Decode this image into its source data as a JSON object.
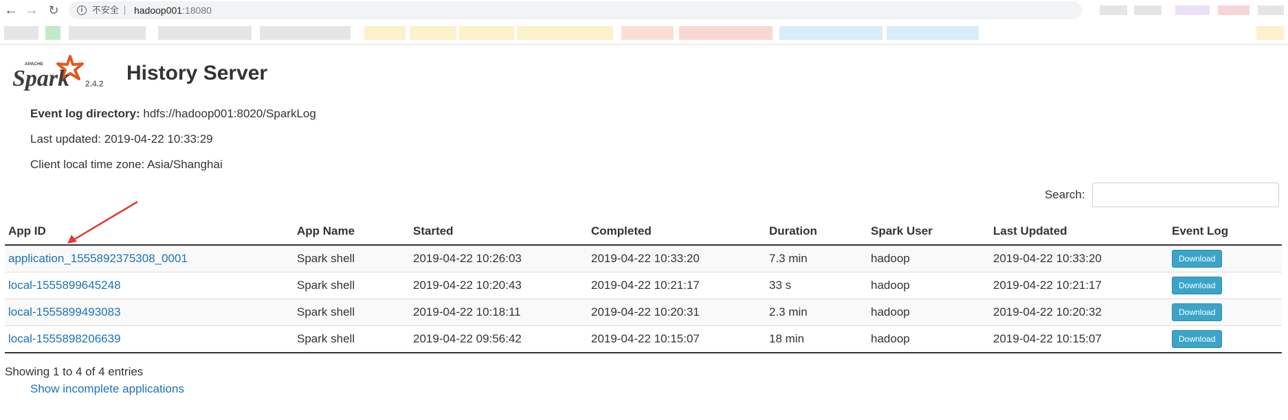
{
  "browser": {
    "insecure_label": "不安全",
    "url_host": "hadoop001",
    "url_port": ":18080"
  },
  "header": {
    "brand": "Spark",
    "brand_small": "APACHE",
    "version": "2.4.2",
    "title": "History Server"
  },
  "info": {
    "event_log_label": "Event log directory:",
    "event_log_value": "hdfs://hadoop001:8020/SparkLog",
    "last_updated": "Last updated: 2019-04-22 10:33:29",
    "timezone": "Client local time zone: Asia/Shanghai"
  },
  "search": {
    "label": "Search:",
    "placeholder": "",
    "value": ""
  },
  "table": {
    "columns": [
      "App ID",
      "App Name",
      "Started",
      "Completed",
      "Duration",
      "Spark User",
      "Last Updated",
      "Event Log"
    ],
    "rows": [
      {
        "app_id": "application_1555892375308_0001",
        "app_name": "Spark shell",
        "started": "2019-04-22 10:26:03",
        "completed": "2019-04-22 10:33:20",
        "duration": "7.3 min",
        "user": "hadoop",
        "last_updated": "2019-04-22 10:33:20",
        "event_log": "Download"
      },
      {
        "app_id": "local-1555899645248",
        "app_name": "Spark shell",
        "started": "2019-04-22 10:20:43",
        "completed": "2019-04-22 10:21:17",
        "duration": "33 s",
        "user": "hadoop",
        "last_updated": "2019-04-22 10:21:17",
        "event_log": "Download"
      },
      {
        "app_id": "local-1555899493083",
        "app_name": "Spark shell",
        "started": "2019-04-22 10:18:11",
        "completed": "2019-04-22 10:20:31",
        "duration": "2.3 min",
        "user": "hadoop",
        "last_updated": "2019-04-22 10:20:32",
        "event_log": "Download"
      },
      {
        "app_id": "local-1555898206639",
        "app_name": "Spark shell",
        "started": "2019-04-22 09:56:42",
        "completed": "2019-04-22 10:15:07",
        "duration": "18 min",
        "user": "hadoop",
        "last_updated": "2019-04-22 10:15:07",
        "event_log": "Download"
      }
    ]
  },
  "footer": {
    "showing": "Showing 1 to 4 of 4 entries",
    "incomplete_link": "Show incomplete applications"
  },
  "colors": {
    "link": "#1a73b8",
    "download_button": "#3ba4c8",
    "annotation_arrow": "#e53935",
    "spark_orange": "#e25a1c"
  }
}
